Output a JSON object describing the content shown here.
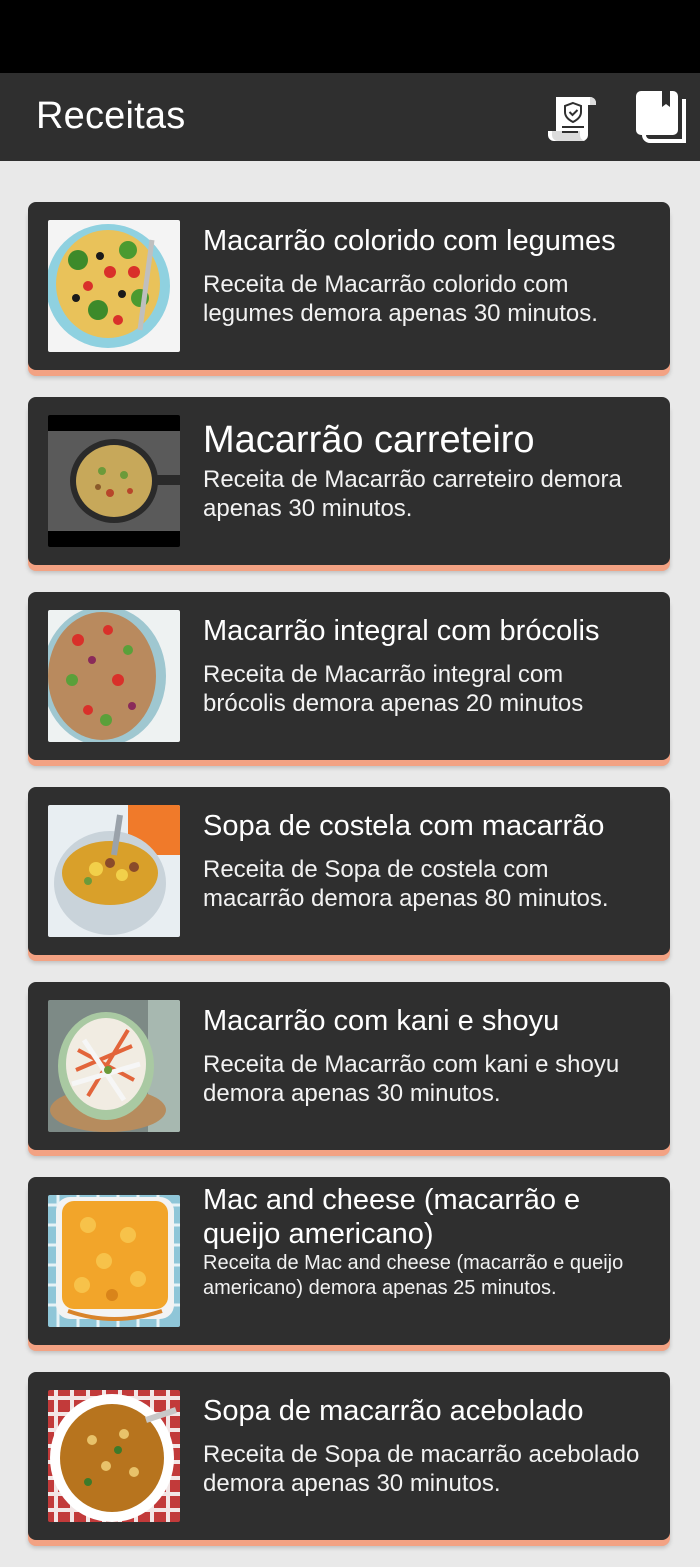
{
  "app_bar": {
    "title": "Receitas",
    "icons": [
      "privacy-policy-icon",
      "recipe-book-icon"
    ]
  },
  "recipes": [
    {
      "title": "Macarrão colorido com legumes",
      "description": "Receita de Macarrão colorido com legumes demora apenas 30 minutos."
    },
    {
      "title": "Macarrão carreteiro",
      "description": "Receita de Macarrão carreteiro demora apenas 30 minutos."
    },
    {
      "title": "Macarrão integral com brócolis",
      "description": "Receita de Macarrão integral com brócolis demora apenas 20 minutos"
    },
    {
      "title": "Sopa de costela com macarrão",
      "description": "Receita de Sopa de costela com macarrão demora apenas 80 minutos."
    },
    {
      "title": "Macarrão com kani e shoyu",
      "description": "Receita de Macarrão com kani e shoyu demora apenas 30 minutos."
    },
    {
      "title": "Mac and cheese (macarrão e queijo americano)",
      "description": "Receita de Mac and cheese (macarrão e queijo americano) demora apenas 25 minutos."
    },
    {
      "title": "Sopa de macarrão acebolado",
      "description": "Receita de Sopa de macarrão acebolado demora apenas 30 minutos."
    }
  ],
  "colors": {
    "status_bar": "#000000",
    "app_bar": "#2f2f2f",
    "card": "#2f2f2f",
    "card_accent": "#f3a283",
    "background": "#e9e9e9"
  }
}
